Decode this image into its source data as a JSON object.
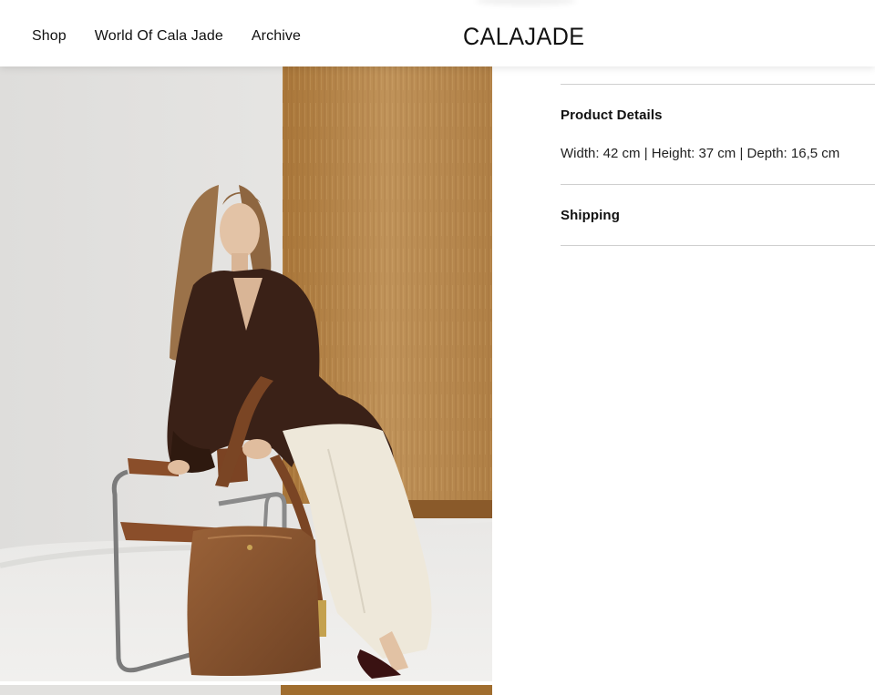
{
  "header": {
    "nav": [
      {
        "label": "Shop"
      },
      {
        "label": "World Of Cala Jade"
      },
      {
        "label": "Archive"
      }
    ],
    "logo": "CALAJADE"
  },
  "product": {
    "accordion": [
      {
        "title": "Product Details",
        "content": "Width: 42 cm | Height: 37 cm | Depth: 16,5 cm",
        "expanded": true
      },
      {
        "title": "Shipping",
        "expanded": false
      }
    ]
  },
  "colors": {
    "background": "#ffffff",
    "text": "#111111",
    "divider": "#cfcfcf",
    "bag_leather": "#8b5a34",
    "coat": "#3a2117",
    "wood_panel": "#b8864a"
  }
}
